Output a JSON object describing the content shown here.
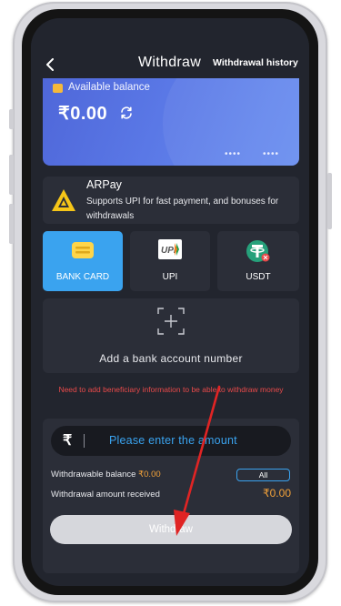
{
  "header": {
    "title": "Withdraw",
    "history_label": "Withdrawal history"
  },
  "balance": {
    "label": "Available balance",
    "value": "₹0.00",
    "card_dots": [
      "••••",
      "••••"
    ]
  },
  "arpay": {
    "name": "ARPay",
    "description": "Supports UPI for fast payment, and bonuses for withdrawals"
  },
  "tabs": [
    {
      "label": "BANK CARD",
      "icon": "bank-card-icon",
      "active": true
    },
    {
      "label": "UPI",
      "icon": "upi-icon",
      "active": false
    },
    {
      "label": "USDT",
      "icon": "usdt-icon",
      "active": false
    }
  ],
  "add_bank": {
    "label": "Add a bank account number"
  },
  "notice": "Need to add beneficiary information to be able to withdraw money",
  "amount": {
    "placeholder": "Please enter the amount",
    "withdrawable_label": "Withdrawable balance ",
    "withdrawable_value": "₹0.00",
    "all_label": "All",
    "received_label": "Withdrawal amount received",
    "received_value": "₹0.00",
    "submit_label": "Withdraw"
  },
  "colors": {
    "accent": "#3aa3ef",
    "background": "#22252e",
    "panel": "#2b2e38",
    "warning": "#e84a4a",
    "amount": "#f3a23a",
    "annotation_arrow": "#e02424"
  }
}
